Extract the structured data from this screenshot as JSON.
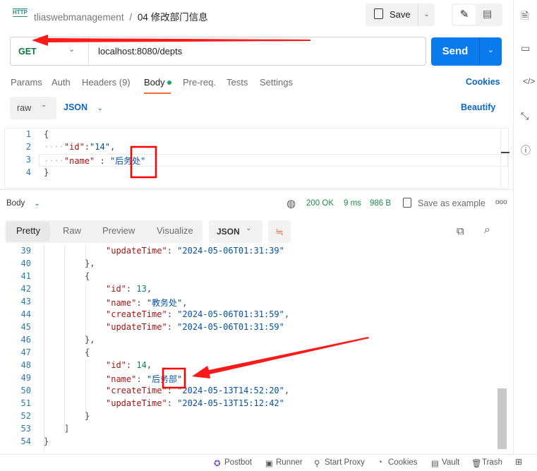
{
  "header": {
    "collection": "tliaswebmanagement",
    "separator": "/",
    "request_name": "04 修改部门信息",
    "save_label": "Save",
    "http_badge": "HTTP"
  },
  "request": {
    "method": "GET",
    "url": "localhost:8080/depts",
    "send_label": "Send"
  },
  "tabs": [
    {
      "label": "Params"
    },
    {
      "label": "Auth"
    },
    {
      "label": "Headers (9)"
    },
    {
      "label": "Body",
      "active": true
    },
    {
      "label": "Pre-req."
    },
    {
      "label": "Tests"
    },
    {
      "label": "Settings"
    }
  ],
  "cookies_label": "Cookies",
  "body_options": {
    "mode": "raw",
    "format": "JSON",
    "beautify_label": "Beautify"
  },
  "request_body": [
    {
      "num": "1",
      "text": "{"
    },
    {
      "num": "2",
      "key": "\"id\"",
      "sep": ":",
      "val": "\"14\"",
      "trail": ","
    },
    {
      "num": "3",
      "key": "\"name\"",
      "sep": " : ",
      "val": "\"后务处\"",
      "trail": ""
    },
    {
      "num": "4",
      "text": "}"
    }
  ],
  "response": {
    "label": "Body",
    "status": "200 OK",
    "time": "9 ms",
    "size": "986 B",
    "save_example": "Save as example",
    "views": [
      "Pretty",
      "Raw",
      "Preview",
      "Visualize"
    ],
    "format": "JSON"
  },
  "response_body": [
    {
      "num": "39",
      "indent": 3,
      "key": "\"updateTime\"",
      "val": "\"2024-05-06T01:31:39\"",
      "type": "s",
      "trail": ""
    },
    {
      "num": "40",
      "indent": 2,
      "text": "},"
    },
    {
      "num": "41",
      "indent": 2,
      "text": "{"
    },
    {
      "num": "42",
      "indent": 3,
      "key": "\"id\"",
      "val": "13",
      "type": "n",
      "trail": ","
    },
    {
      "num": "43",
      "indent": 3,
      "key": "\"name\"",
      "val": "\"教务处\"",
      "type": "s",
      "trail": ","
    },
    {
      "num": "44",
      "indent": 3,
      "key": "\"createTime\"",
      "val": "\"2024-05-06T01:31:59\"",
      "type": "s",
      "trail": ","
    },
    {
      "num": "45",
      "indent": 3,
      "key": "\"updateTime\"",
      "val": "\"2024-05-06T01:31:59\"",
      "type": "s",
      "trail": ""
    },
    {
      "num": "46",
      "indent": 2,
      "text": "},"
    },
    {
      "num": "47",
      "indent": 2,
      "text": "{"
    },
    {
      "num": "48",
      "indent": 3,
      "key": "\"id\"",
      "val": "14",
      "type": "n",
      "trail": ","
    },
    {
      "num": "49",
      "indent": 3,
      "key": "\"name\"",
      "val": "\"后务部\"",
      "type": "s",
      "trail": ","
    },
    {
      "num": "50",
      "indent": 3,
      "key": "\"createTime\"",
      "val": "\"2024-05-13T14:52:20\"",
      "type": "s",
      "trail": ","
    },
    {
      "num": "51",
      "indent": 3,
      "key": "\"updateTime\"",
      "val": "\"2024-05-13T15:12:42\"",
      "type": "s",
      "trail": ""
    },
    {
      "num": "52",
      "indent": 2,
      "text": "}"
    },
    {
      "num": "53",
      "indent": 1,
      "text": "]"
    },
    {
      "num": "54",
      "indent": 0,
      "text": "}"
    }
  ],
  "statusbar": [
    {
      "label": "Postbot",
      "icon": "postbot-icon"
    },
    {
      "label": "Runner",
      "icon": "runner-icon"
    },
    {
      "label": "Start Proxy",
      "icon": "proxy-icon"
    },
    {
      "label": "Cookies",
      "icon": "cookie-icon"
    },
    {
      "label": "Vault",
      "icon": "vault-icon"
    },
    {
      "label": "Trash",
      "icon": "trash-icon"
    }
  ],
  "colors": {
    "accent": "#097bed",
    "method_get": "#0b7a3b",
    "annotation": "#ff0000",
    "status_ok": "#1f8a4c"
  }
}
